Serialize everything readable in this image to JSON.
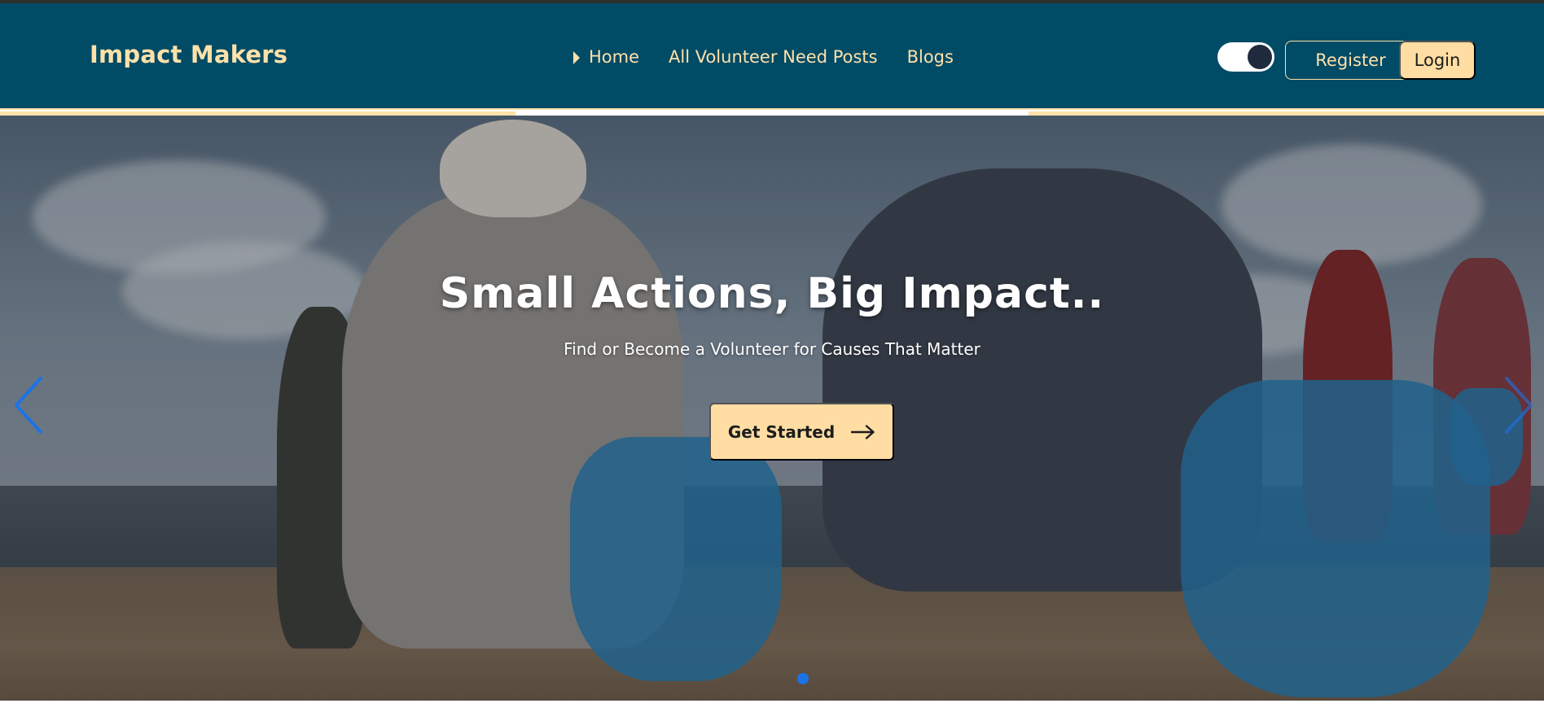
{
  "brand": {
    "name": "Impact Makers"
  },
  "nav": {
    "links": [
      {
        "label": "Home"
      },
      {
        "label": "All Volunteer Need Posts"
      },
      {
        "label": "Blogs"
      }
    ],
    "theme_toggle": {
      "state": "dark"
    },
    "register_label": "Register",
    "login_label": "Login"
  },
  "hero": {
    "title": "Small Actions, Big Impact..",
    "subtitle": "Find or Become a Volunteer for Causes That Matter",
    "cta_label": "Get Started",
    "prev_icon": "chevron-left-icon",
    "next_icon": "chevron-right-icon",
    "indicator_count": 1,
    "active_slide": 1
  },
  "colors": {
    "navbar_bg": "#004b66",
    "accent": "#ffe1a9",
    "button_fill": "#ffdda3",
    "carousel_control": "#1a73e8"
  }
}
